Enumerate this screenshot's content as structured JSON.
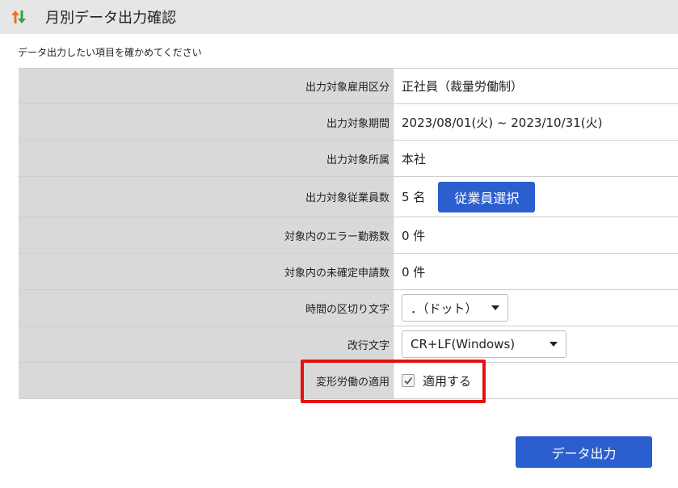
{
  "header": {
    "title": "月別データ出力確認",
    "icon": "sort-arrows-icon",
    "icon_colors": {
      "up": "#e0752a",
      "down": "#3aa04a"
    }
  },
  "subtitle": "データ出力したい項目を確かめてください",
  "rows": [
    {
      "label": "出力対象雇用区分",
      "value": "正社員（裁量労働制）"
    },
    {
      "label": "出力対象期間",
      "value": "2023/08/01(火) ~ 2023/10/31(火)"
    },
    {
      "label": "出力対象所属",
      "value": "本社"
    },
    {
      "label": "出力対象従業員数",
      "value": "5 名",
      "button": "従業員選択"
    },
    {
      "label": "対象内のエラー勤務数",
      "value": "0 件"
    },
    {
      "label": "対象内の未確定申請数",
      "value": "0 件"
    },
    {
      "label": "時間の区切り文字",
      "select": "．（ドット）"
    },
    {
      "label": "改行文字",
      "select": "CR+LF(Windows)"
    },
    {
      "label": "変形労働の適用",
      "checkbox_label": "適用する",
      "checked": true
    }
  ],
  "export_button": "データ出力",
  "colors": {
    "accent": "#2b5fd0",
    "highlight": "#e51010",
    "label_bg": "#d9d9d9",
    "header_bg": "#e6e6e6"
  }
}
